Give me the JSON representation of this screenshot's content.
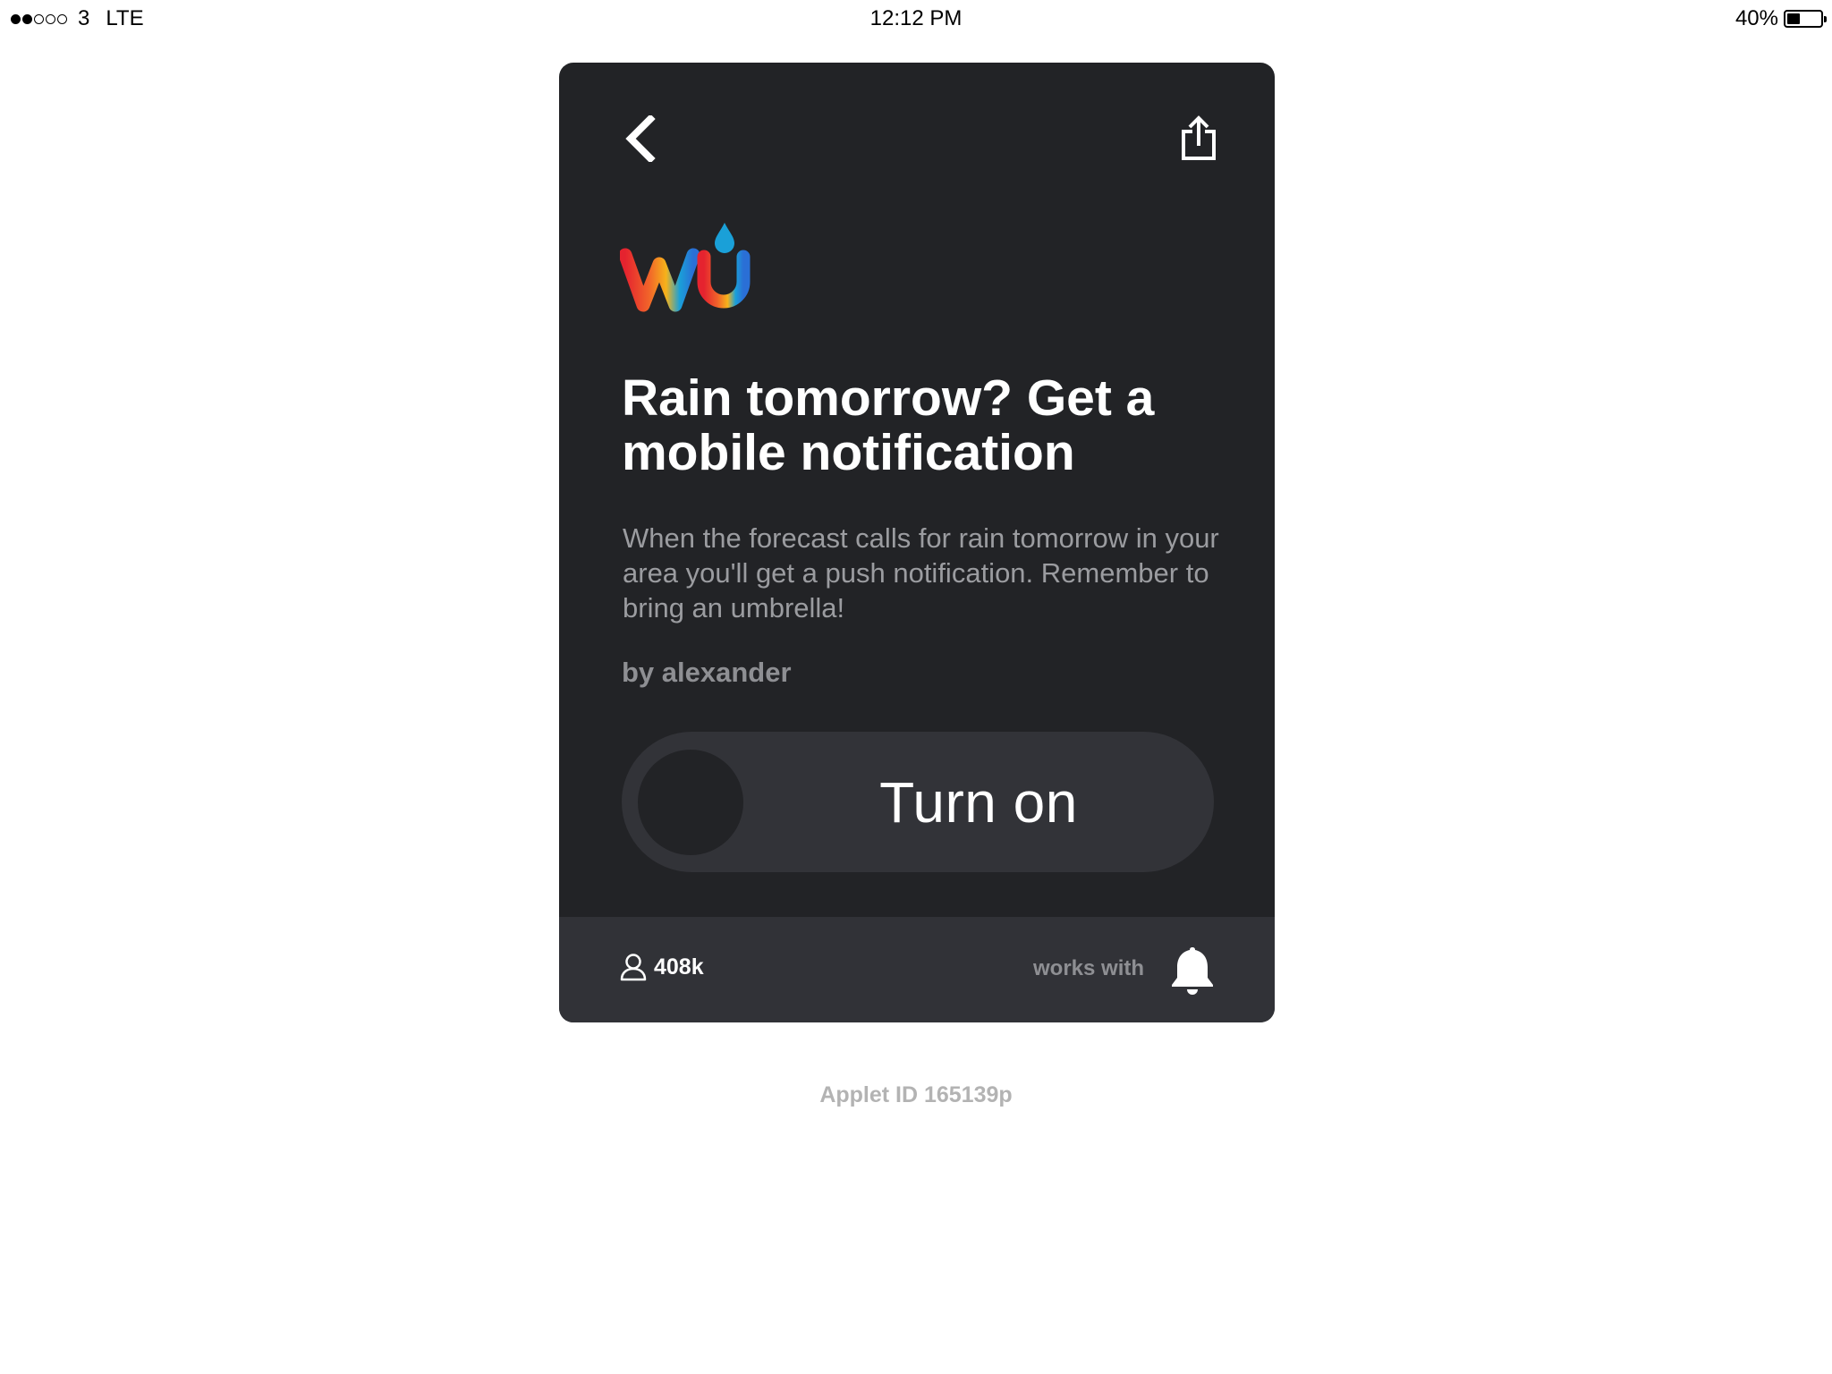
{
  "status_bar": {
    "carrier": "3",
    "network": "LTE",
    "time": "12:12 PM",
    "battery_text": "40%",
    "battery_level": 0.4,
    "signal_bars_filled": 2,
    "signal_bars_total": 5
  },
  "card": {
    "service_logo": "weather-underground-logo",
    "title": "Rain tomorrow? Get a mobile notification",
    "description": "When the forecast calls for rain tomorrow in your area you'll get a push notification. Remember to bring an umbrella!",
    "author": "by alexander",
    "toggle_label": "Turn on",
    "toggle_on": false,
    "user_count": "408k",
    "works_with_label": "works with",
    "works_with_icon": "bell-icon",
    "colors": {
      "card_background": "#222326",
      "footer_background": "#313237",
      "toggle_track": "#323338"
    }
  },
  "applet_id": "Applet ID 165139p"
}
